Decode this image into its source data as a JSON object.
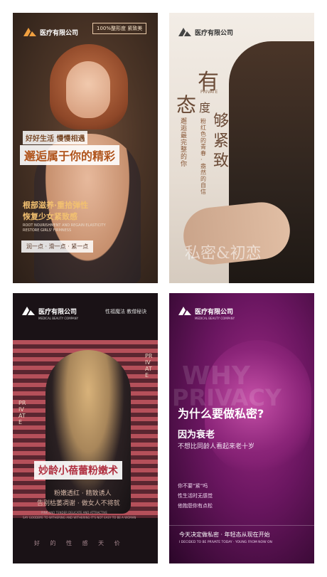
{
  "panel1": {
    "logo_text": "医疗有限公司",
    "badge": "100%整形度 紧致美",
    "tagline": "好好生活 慢慢相遇",
    "headline": "邂逅属于你的精彩",
    "sub1": "根部滋养·重拾弹性",
    "sub2": "恢复少女紧致感",
    "en1": "ROOT NOURISHMENT AND REGAIN ELASTICITY",
    "en2": "RESTORE GIRLS' FIRMNESS",
    "pill": "润一点 · 滑一点 · 紧一点"
  },
  "panel2": {
    "logo_text": "医疗有限公司",
    "char1": "有",
    "char2": "态",
    "char3": "度",
    "private": "PRIVATE",
    "char4": "够",
    "char5": "紧",
    "char6": "致",
    "vert_left": "邂逅最完整的你",
    "vert_mid": "粉红色的青春·盎然的自信",
    "watermark": "私密&初恋"
  },
  "panel3": {
    "logo_text": "医疗有限公司",
    "logo_sub": "MEDICAL BEAUTY COMPANY",
    "top_right": "性福魔法 教僧秘诀",
    "private_left": "PRIVATE",
    "private_right": "PRIVATE",
    "headline": "妙龄小蓓蕾粉嫩术",
    "line1": "粉嫩透红 · 精致诱人",
    "line2": "告别枯萎凋谢 · 做女人不将就",
    "en1": "PINK AND TENDER DELICATE AND ATTRACTIVE",
    "en2": "SAY GOODBYE TO WITHERING AND WITHERING IT'S NOT EASY TO BE A WOMAN",
    "footer": "好 的 性 感 天 价"
  },
  "panel4": {
    "logo_text": "医疗有限公司",
    "logo_sub": "MEDICAL BEAUTY COMPANY",
    "bg1": "WHY",
    "bg2": "PRIVACY",
    "question": "为什么要做私密?",
    "answer": "因为衰老",
    "subline": "不想比同龄人看起来老十岁",
    "item1": "你不要“紧”吗",
    "item2": "性生活时无感觉",
    "item3": "他抱怨你有点松",
    "footer_cn": "今天决定做私密 · 年轻态从现在开始",
    "footer_en": "I DECIDED TO BE PRIVATE TODAY · YOUNG FROM NOW ON"
  }
}
